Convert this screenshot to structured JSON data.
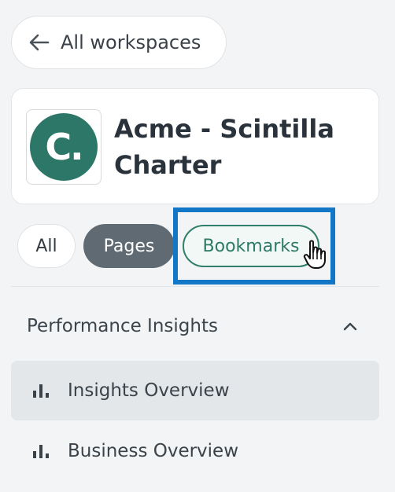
{
  "back": {
    "label": "All workspaces"
  },
  "workspace": {
    "logo_text": "C.",
    "name": "Acme - Scintilla Charter",
    "logo_color": "#2d7768"
  },
  "filters": {
    "items": [
      {
        "label": "All",
        "state": "default"
      },
      {
        "label": "Pages",
        "state": "selected"
      },
      {
        "label": "Bookmarks",
        "state": "hovered"
      }
    ]
  },
  "section": {
    "title": "Performance Insights",
    "expanded": true,
    "items": [
      {
        "label": "Insights Overview",
        "icon": "bar-chart-icon",
        "active": true
      },
      {
        "label": "Business Overview",
        "icon": "bar-chart-icon",
        "active": false
      }
    ]
  },
  "colors": {
    "accent": "#2d7a66",
    "highlight": "#1377c7",
    "selected_chip": "#5f6a73"
  }
}
